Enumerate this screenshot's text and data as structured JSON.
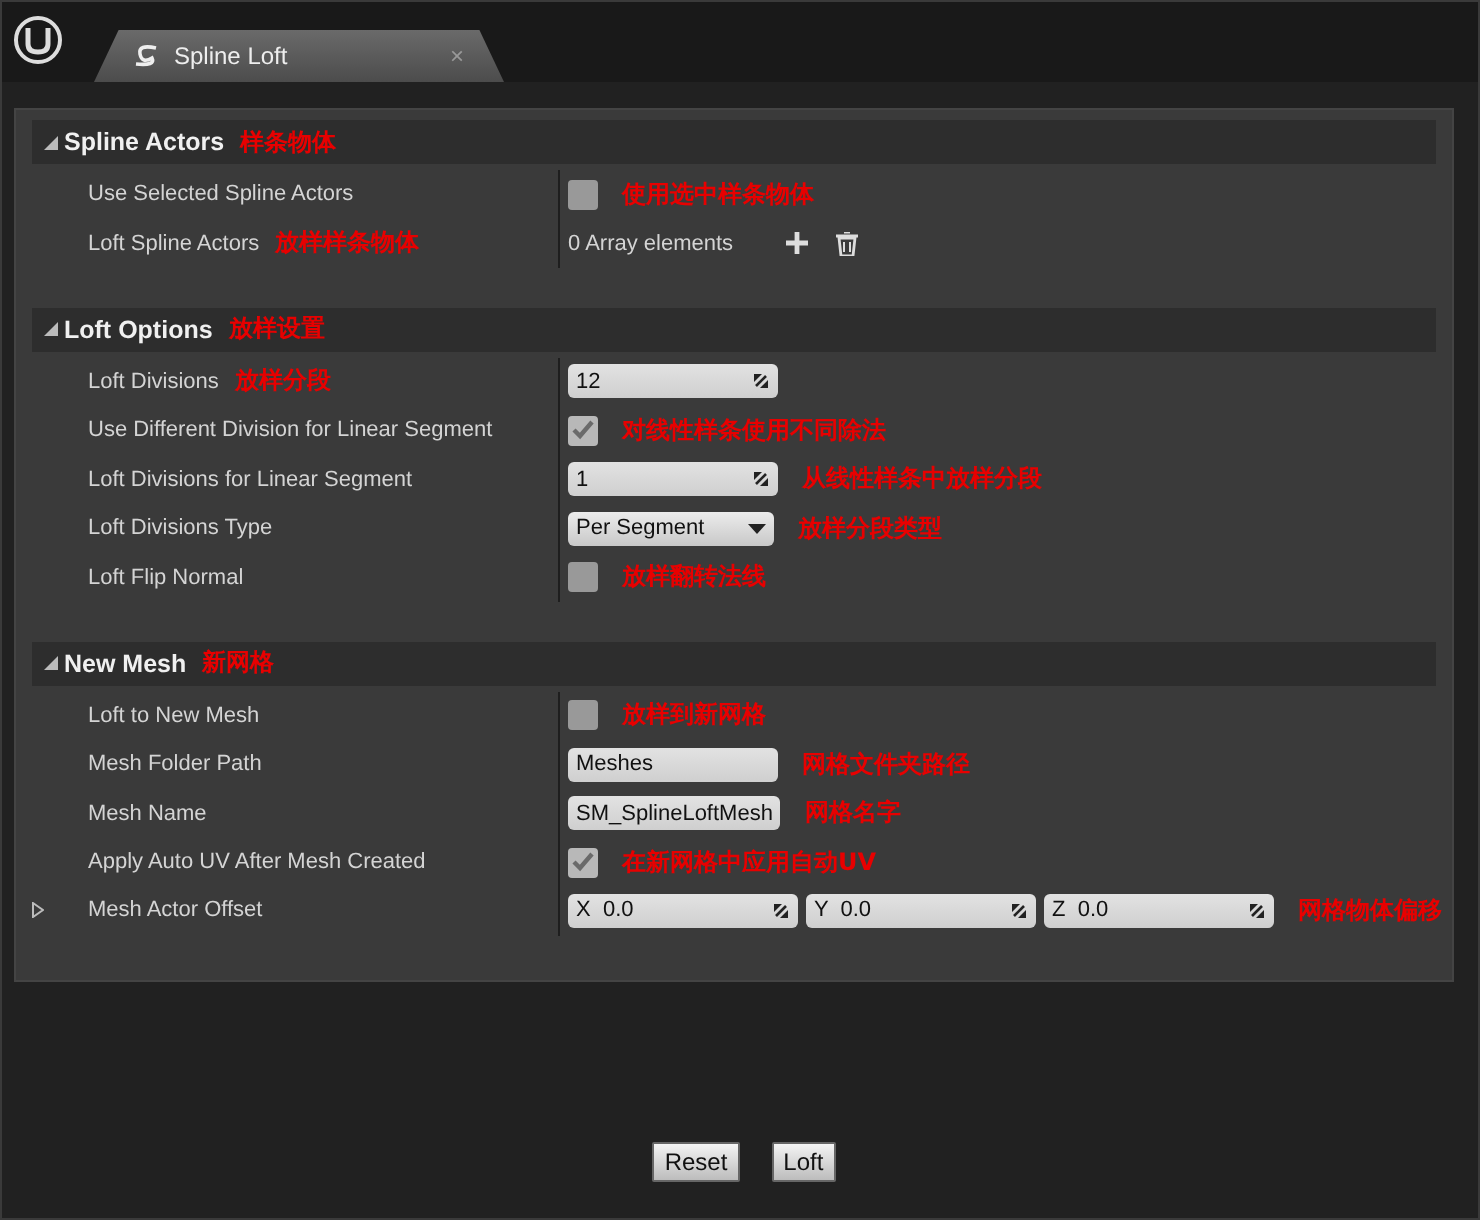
{
  "window": {
    "tab": {
      "label": "Spline Loft",
      "close": "×"
    }
  },
  "sections": [
    {
      "title": "Spline Actors",
      "note": "样条物体",
      "expanded": true,
      "rows": [
        {
          "kind": "checkbox",
          "label": "Use Selected Spline Actors",
          "checked": false,
          "note": "使用选中样条物体",
          "note_in_label": false
        },
        {
          "kind": "array",
          "label": "Loft Spline Actors",
          "value": "0 Array elements",
          "note": "放样样条物体",
          "note_in_label": true
        }
      ]
    },
    {
      "title": "Loft Options",
      "note": "放样设置",
      "expanded": true,
      "rows": [
        {
          "kind": "number",
          "label": "Loft Divisions",
          "value": "12",
          "note": "放样分段",
          "note_in_label": true
        },
        {
          "kind": "checkbox",
          "label": "Use Different Division for Linear Segment",
          "checked": true,
          "note": "对线性样条使用不同除法",
          "note_in_label": false
        },
        {
          "kind": "number",
          "label": "Loft Divisions for Linear Segment",
          "value": "1",
          "note": "从线性样条中放样分段",
          "note_in_label": false
        },
        {
          "kind": "dropdown",
          "label": "Loft Divisions Type",
          "value": "Per Segment",
          "note": "放样分段类型",
          "note_in_label": false
        },
        {
          "kind": "checkbox",
          "label": "Loft Flip Normal",
          "checked": false,
          "note": "放样翻转法线",
          "note_in_label": false
        }
      ]
    },
    {
      "title": "New Mesh",
      "note": "新网格",
      "expanded": true,
      "rows": [
        {
          "kind": "checkbox",
          "label": "Loft to New Mesh",
          "checked": false,
          "note": "放样到新网格",
          "note_in_label": false
        },
        {
          "kind": "text",
          "label": "Mesh Folder Path",
          "value": "Meshes",
          "note": "网格文件夹路径",
          "note_in_label": false
        },
        {
          "kind": "text",
          "label": "Mesh Name",
          "value": "SM_SplineLoftMesh",
          "note": "网格名字",
          "note_in_label": false
        },
        {
          "kind": "checkbox",
          "label": "Apply Auto UV After Mesh Created",
          "checked": true,
          "note": "在新网格中应用自动UV",
          "note_in_label": false
        },
        {
          "kind": "vector",
          "label": "Mesh Actor Offset",
          "expanded": false,
          "components": [
            {
              "axis": "X",
              "value": "0.0"
            },
            {
              "axis": "Y",
              "value": "0.0"
            },
            {
              "axis": "Z",
              "value": "0.0"
            }
          ],
          "note": "网格物体偏移",
          "note_in_label": false
        }
      ]
    }
  ],
  "buttons": [
    "Reset",
    "Loft"
  ]
}
